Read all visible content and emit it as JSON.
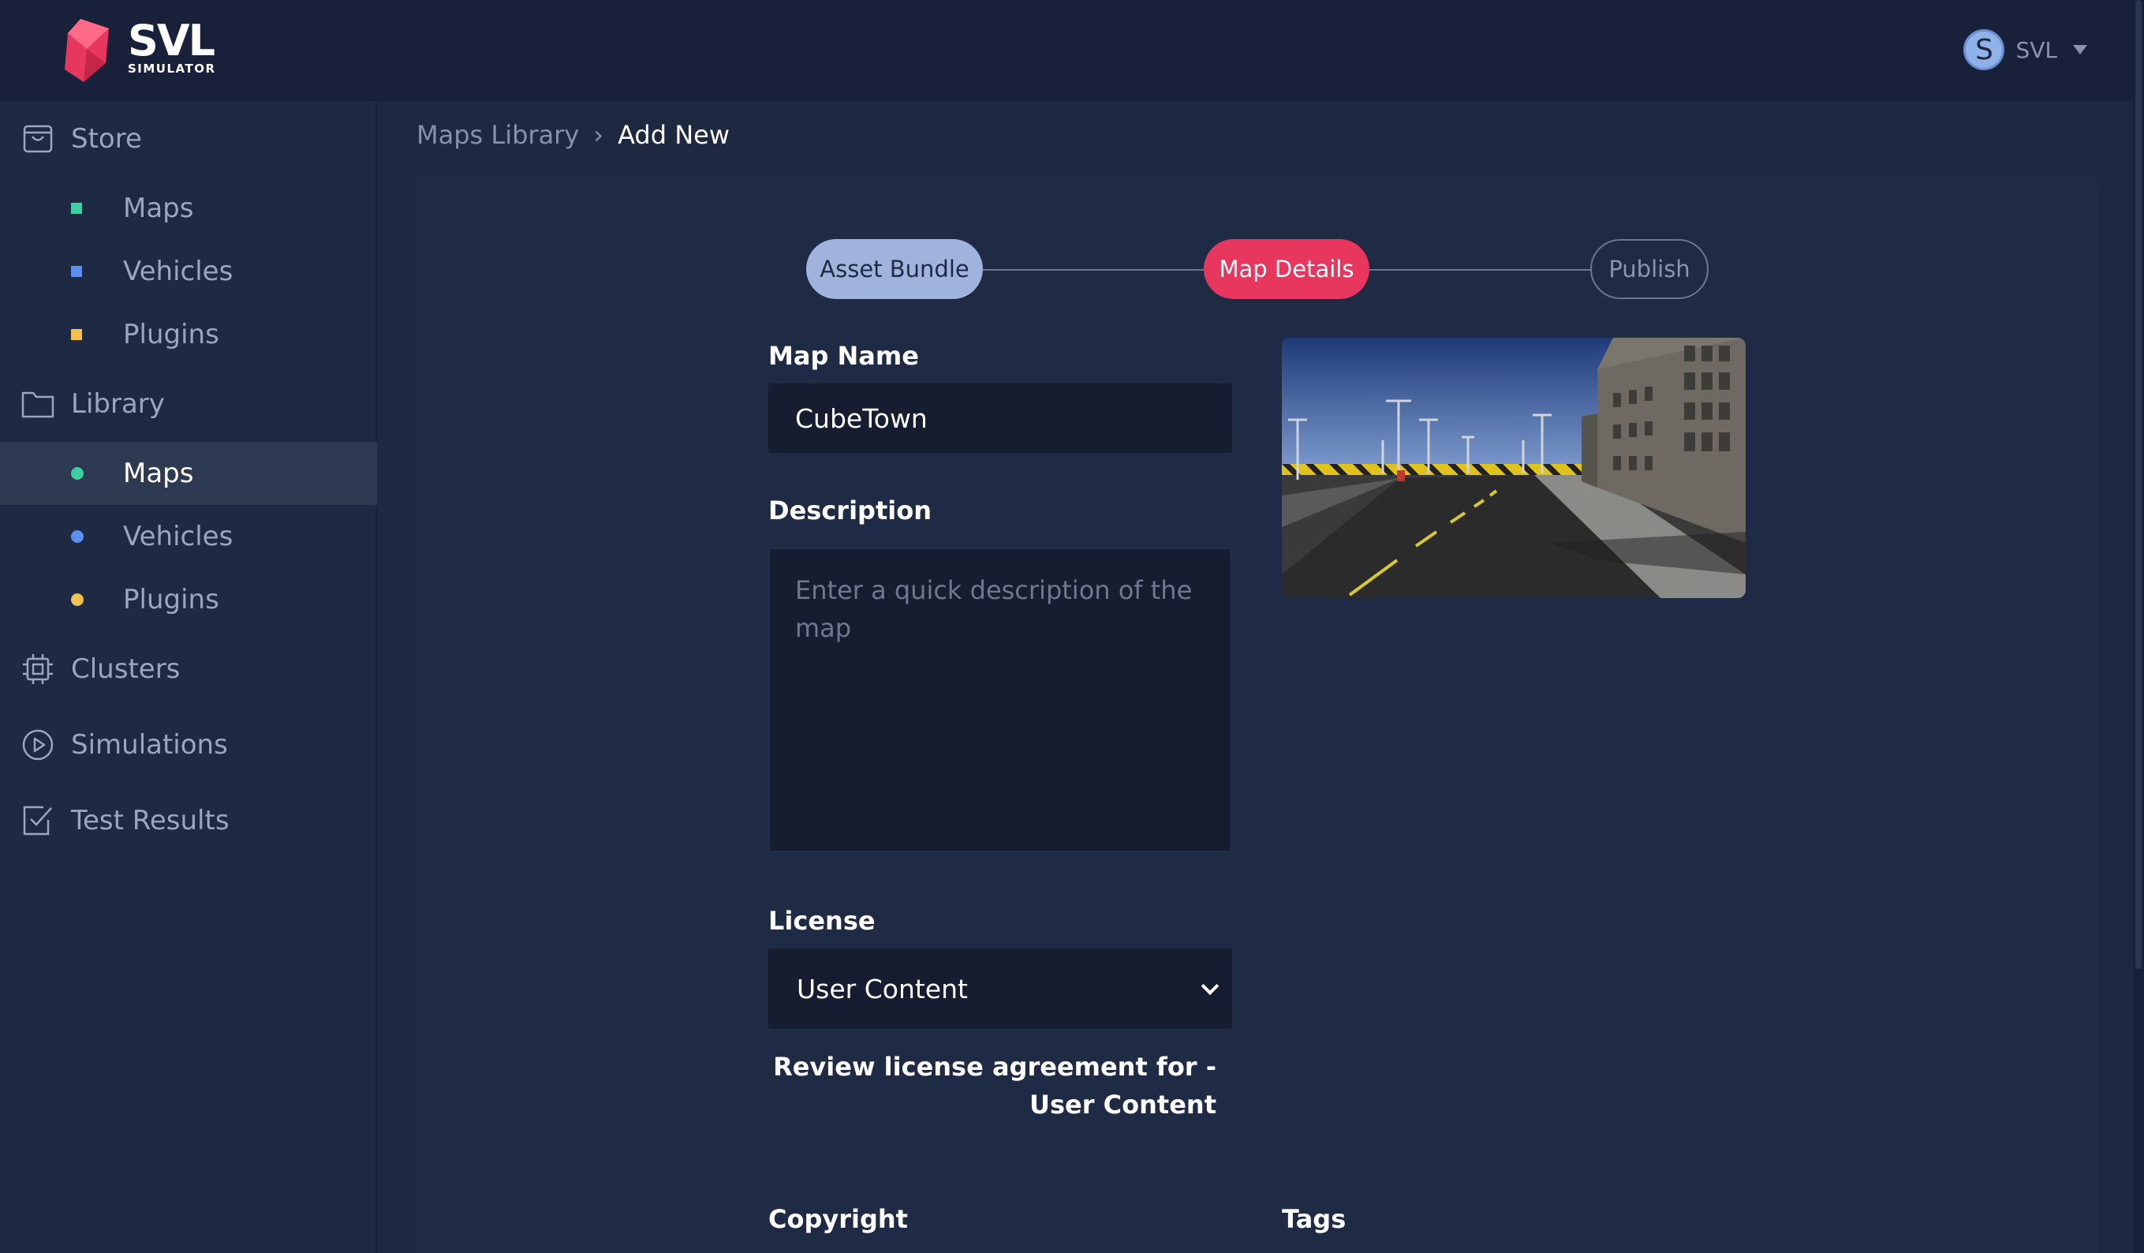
{
  "header": {
    "brand_word": "SVL",
    "brand_sub": "SIMULATOR",
    "user_initial": "S",
    "user_name": "SVL"
  },
  "sidebar": {
    "store": {
      "label": "Store",
      "items": [
        {
          "label": "Maps",
          "color": "#3ccfa0"
        },
        {
          "label": "Vehicles",
          "color": "#5b8ff0"
        },
        {
          "label": "Plugins",
          "color": "#f2c14e"
        }
      ]
    },
    "library": {
      "label": "Library",
      "items": [
        {
          "label": "Maps",
          "color": "#3ccfa0"
        },
        {
          "label": "Vehicles",
          "color": "#5b8ff0"
        },
        {
          "label": "Plugins",
          "color": "#f2c14e"
        }
      ]
    },
    "clusters": "Clusters",
    "simulations": "Simulations",
    "test_results": "Test Results"
  },
  "breadcrumb": {
    "parent": "Maps Library",
    "separator": "›",
    "current": "Add New"
  },
  "stepper": {
    "steps": [
      "Asset Bundle",
      "Map Details",
      "Publish"
    ]
  },
  "form": {
    "map_name_label": "Map Name",
    "map_name_value": "CubeTown",
    "description_label": "Description",
    "description_placeholder": "Enter a quick description of the map",
    "license_label": "License",
    "license_value": "User Content",
    "license_link": "Review license agreement for - User Content",
    "copyright_label": "Copyright",
    "tags_label": "Tags"
  },
  "colors": {
    "accent": "#e8375f",
    "background": "#1e2840",
    "panel": "#1f2b45"
  }
}
